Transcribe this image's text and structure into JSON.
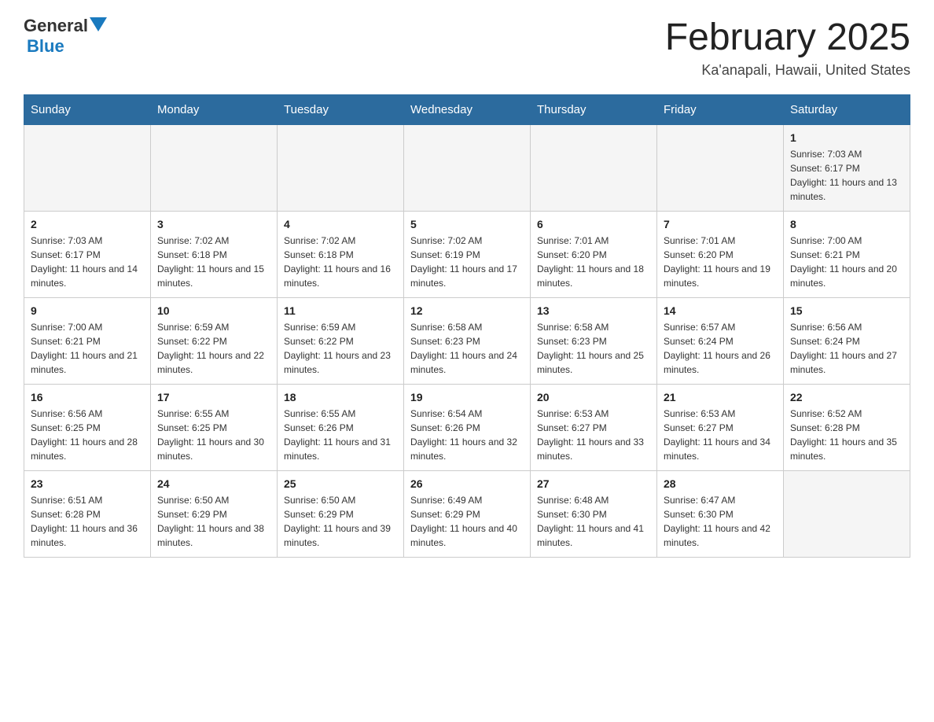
{
  "header": {
    "logo_general": "General",
    "logo_blue": "Blue",
    "month_title": "February 2025",
    "location": "Ka'anapali, Hawaii, United States"
  },
  "days_of_week": [
    "Sunday",
    "Monday",
    "Tuesday",
    "Wednesday",
    "Thursday",
    "Friday",
    "Saturday"
  ],
  "weeks": [
    [
      null,
      null,
      null,
      null,
      null,
      null,
      {
        "day": "1",
        "sunrise": "Sunrise: 7:03 AM",
        "sunset": "Sunset: 6:17 PM",
        "daylight": "Daylight: 11 hours and 13 minutes."
      }
    ],
    [
      {
        "day": "2",
        "sunrise": "Sunrise: 7:03 AM",
        "sunset": "Sunset: 6:17 PM",
        "daylight": "Daylight: 11 hours and 14 minutes."
      },
      {
        "day": "3",
        "sunrise": "Sunrise: 7:02 AM",
        "sunset": "Sunset: 6:18 PM",
        "daylight": "Daylight: 11 hours and 15 minutes."
      },
      {
        "day": "4",
        "sunrise": "Sunrise: 7:02 AM",
        "sunset": "Sunset: 6:18 PM",
        "daylight": "Daylight: 11 hours and 16 minutes."
      },
      {
        "day": "5",
        "sunrise": "Sunrise: 7:02 AM",
        "sunset": "Sunset: 6:19 PM",
        "daylight": "Daylight: 11 hours and 17 minutes."
      },
      {
        "day": "6",
        "sunrise": "Sunrise: 7:01 AM",
        "sunset": "Sunset: 6:20 PM",
        "daylight": "Daylight: 11 hours and 18 minutes."
      },
      {
        "day": "7",
        "sunrise": "Sunrise: 7:01 AM",
        "sunset": "Sunset: 6:20 PM",
        "daylight": "Daylight: 11 hours and 19 minutes."
      },
      {
        "day": "8",
        "sunrise": "Sunrise: 7:00 AM",
        "sunset": "Sunset: 6:21 PM",
        "daylight": "Daylight: 11 hours and 20 minutes."
      }
    ],
    [
      {
        "day": "9",
        "sunrise": "Sunrise: 7:00 AM",
        "sunset": "Sunset: 6:21 PM",
        "daylight": "Daylight: 11 hours and 21 minutes."
      },
      {
        "day": "10",
        "sunrise": "Sunrise: 6:59 AM",
        "sunset": "Sunset: 6:22 PM",
        "daylight": "Daylight: 11 hours and 22 minutes."
      },
      {
        "day": "11",
        "sunrise": "Sunrise: 6:59 AM",
        "sunset": "Sunset: 6:22 PM",
        "daylight": "Daylight: 11 hours and 23 minutes."
      },
      {
        "day": "12",
        "sunrise": "Sunrise: 6:58 AM",
        "sunset": "Sunset: 6:23 PM",
        "daylight": "Daylight: 11 hours and 24 minutes."
      },
      {
        "day": "13",
        "sunrise": "Sunrise: 6:58 AM",
        "sunset": "Sunset: 6:23 PM",
        "daylight": "Daylight: 11 hours and 25 minutes."
      },
      {
        "day": "14",
        "sunrise": "Sunrise: 6:57 AM",
        "sunset": "Sunset: 6:24 PM",
        "daylight": "Daylight: 11 hours and 26 minutes."
      },
      {
        "day": "15",
        "sunrise": "Sunrise: 6:56 AM",
        "sunset": "Sunset: 6:24 PM",
        "daylight": "Daylight: 11 hours and 27 minutes."
      }
    ],
    [
      {
        "day": "16",
        "sunrise": "Sunrise: 6:56 AM",
        "sunset": "Sunset: 6:25 PM",
        "daylight": "Daylight: 11 hours and 28 minutes."
      },
      {
        "day": "17",
        "sunrise": "Sunrise: 6:55 AM",
        "sunset": "Sunset: 6:25 PM",
        "daylight": "Daylight: 11 hours and 30 minutes."
      },
      {
        "day": "18",
        "sunrise": "Sunrise: 6:55 AM",
        "sunset": "Sunset: 6:26 PM",
        "daylight": "Daylight: 11 hours and 31 minutes."
      },
      {
        "day": "19",
        "sunrise": "Sunrise: 6:54 AM",
        "sunset": "Sunset: 6:26 PM",
        "daylight": "Daylight: 11 hours and 32 minutes."
      },
      {
        "day": "20",
        "sunrise": "Sunrise: 6:53 AM",
        "sunset": "Sunset: 6:27 PM",
        "daylight": "Daylight: 11 hours and 33 minutes."
      },
      {
        "day": "21",
        "sunrise": "Sunrise: 6:53 AM",
        "sunset": "Sunset: 6:27 PM",
        "daylight": "Daylight: 11 hours and 34 minutes."
      },
      {
        "day": "22",
        "sunrise": "Sunrise: 6:52 AM",
        "sunset": "Sunset: 6:28 PM",
        "daylight": "Daylight: 11 hours and 35 minutes."
      }
    ],
    [
      {
        "day": "23",
        "sunrise": "Sunrise: 6:51 AM",
        "sunset": "Sunset: 6:28 PM",
        "daylight": "Daylight: 11 hours and 36 minutes."
      },
      {
        "day": "24",
        "sunrise": "Sunrise: 6:50 AM",
        "sunset": "Sunset: 6:29 PM",
        "daylight": "Daylight: 11 hours and 38 minutes."
      },
      {
        "day": "25",
        "sunrise": "Sunrise: 6:50 AM",
        "sunset": "Sunset: 6:29 PM",
        "daylight": "Daylight: 11 hours and 39 minutes."
      },
      {
        "day": "26",
        "sunrise": "Sunrise: 6:49 AM",
        "sunset": "Sunset: 6:29 PM",
        "daylight": "Daylight: 11 hours and 40 minutes."
      },
      {
        "day": "27",
        "sunrise": "Sunrise: 6:48 AM",
        "sunset": "Sunset: 6:30 PM",
        "daylight": "Daylight: 11 hours and 41 minutes."
      },
      {
        "day": "28",
        "sunrise": "Sunrise: 6:47 AM",
        "sunset": "Sunset: 6:30 PM",
        "daylight": "Daylight: 11 hours and 42 minutes."
      },
      null
    ]
  ]
}
